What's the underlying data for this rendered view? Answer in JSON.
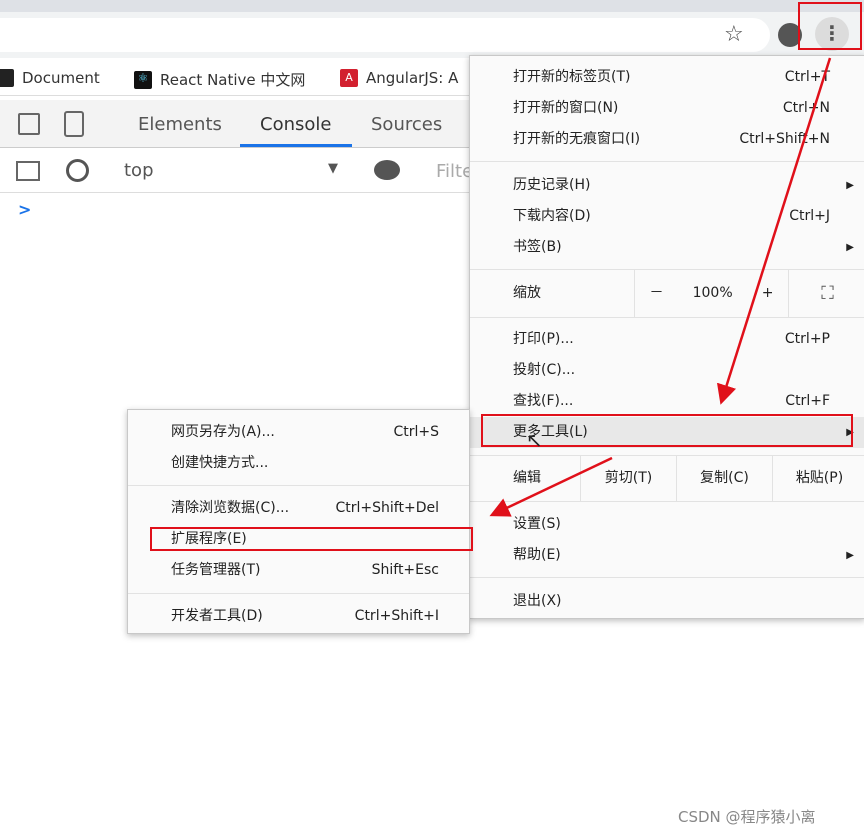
{
  "browser": {
    "bookmarks": [
      {
        "label": "Document",
        "icon": "aws-icon"
      },
      {
        "label": "React Native 中文网",
        "icon": "react-icon"
      },
      {
        "label": "AngularJS: A",
        "icon": "angular-icon"
      }
    ]
  },
  "devtools": {
    "tabs": [
      "Elements",
      "Console",
      "Sources"
    ],
    "active_tab": "Console",
    "context": "top",
    "filter_placeholder": "Filter",
    "prompt": ">"
  },
  "main_menu": {
    "items_top": [
      {
        "label": "打开新的标签页(T)",
        "shortcut": "Ctrl+T"
      },
      {
        "label": "打开新的窗口(N)",
        "shortcut": "Ctrl+N"
      },
      {
        "label": "打开新的无痕窗口(I)",
        "shortcut": "Ctrl+Shift+N"
      }
    ],
    "items_history": [
      {
        "label": "历史记录(H)",
        "submenu": true
      },
      {
        "label": "下载内容(D)",
        "shortcut": "Ctrl+J"
      },
      {
        "label": "书签(B)",
        "submenu": true
      }
    ],
    "zoom": {
      "label": "缩放",
      "minus": "－",
      "value": "100%",
      "plus": "+"
    },
    "items_tools": [
      {
        "label": "打印(P)...",
        "shortcut": "Ctrl+P"
      },
      {
        "label": "投射(C)..."
      },
      {
        "label": "查找(F)...",
        "shortcut": "Ctrl+F"
      },
      {
        "label": "更多工具(L)",
        "submenu": true
      }
    ],
    "edit": {
      "label": "编辑",
      "cut": "剪切(T)",
      "copy": "复制(C)",
      "paste": "粘贴(P)"
    },
    "items_settings": [
      {
        "label": "设置(S)"
      },
      {
        "label": "帮助(E)",
        "submenu": true
      }
    ],
    "exit": "退出(X)"
  },
  "sub_menu": {
    "items": [
      {
        "label": "网页另存为(A)...",
        "shortcut": "Ctrl+S"
      },
      {
        "label": "创建快捷方式..."
      },
      {
        "label": "清除浏览数据(C)...",
        "shortcut": "Ctrl+Shift+Del"
      },
      {
        "label": "扩展程序(E)"
      },
      {
        "label": "任务管理器(T)",
        "shortcut": "Shift+Esc"
      },
      {
        "label": "开发者工具(D)",
        "shortcut": "Ctrl+Shift+I"
      }
    ]
  },
  "watermark": "CSDN @程序猿小离",
  "colors": {
    "annotation_red": "#e0101a",
    "devtools_blue": "#1a73e8",
    "highlight": "#e8e8e8"
  }
}
